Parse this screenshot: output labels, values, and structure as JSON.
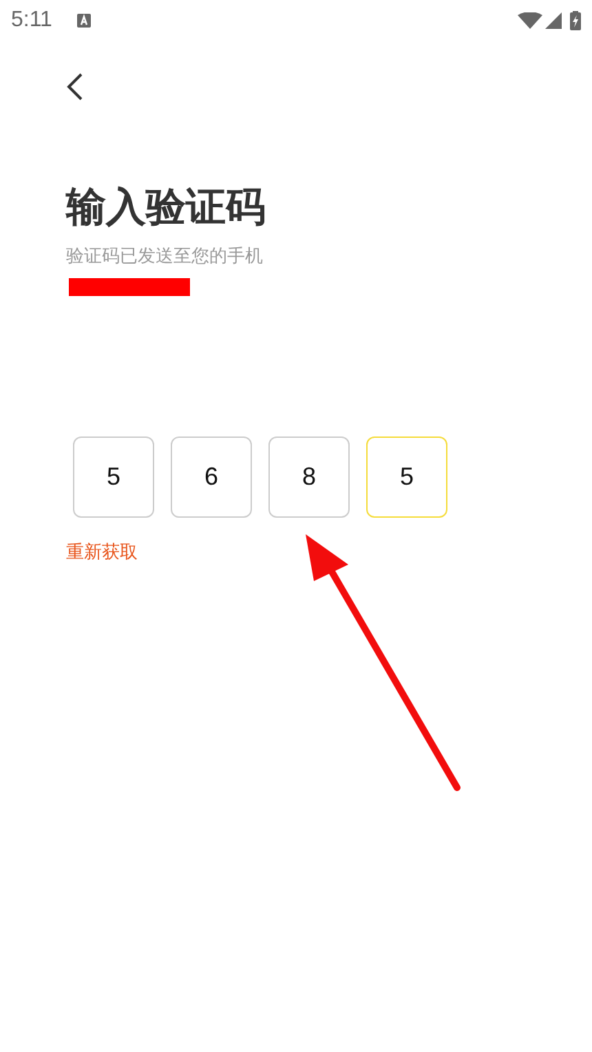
{
  "status_bar": {
    "time": "5:11"
  },
  "title": "输入验证码",
  "subtitle": "验证码已发送至您的手机",
  "code_boxes": [
    {
      "digit": "5",
      "selected": false
    },
    {
      "digit": "6",
      "selected": false
    },
    {
      "digit": "8",
      "selected": false
    },
    {
      "digit": "5",
      "selected": true
    }
  ],
  "resend_link": "重新获取"
}
